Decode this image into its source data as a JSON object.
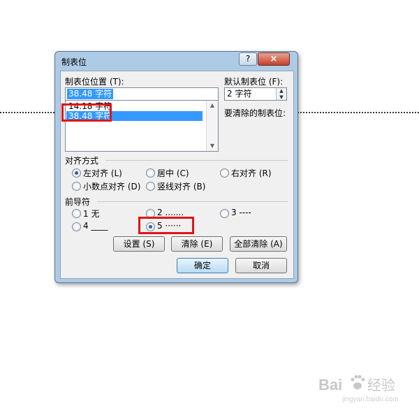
{
  "dialog": {
    "title": "制表位",
    "help_label": "?",
    "close_label": "×"
  },
  "tab_position": {
    "label": "制表位位置 (T):",
    "value": "38.48 字符",
    "list": [
      "14.18 字符",
      "38.48 字符"
    ]
  },
  "default_tab": {
    "label": "默认制表位 (F):",
    "value": "2 字符"
  },
  "clear_label": "要清除的制表位:",
  "alignment": {
    "heading": "对齐方式",
    "options": [
      "左对齐 (L)",
      "居中 (C)",
      "右对齐 (R)",
      "小数点对齐 (D)",
      "竖线对齐 (B)"
    ],
    "selected": "左对齐 (L)"
  },
  "leader": {
    "heading": "前导符",
    "options": [
      "1 无",
      "2 .......",
      "3 ----",
      "4 ____",
      "5 ······"
    ],
    "selected": "5 ······"
  },
  "buttons": {
    "set": "设置 (S)",
    "clear": "清除 (E)",
    "clear_all": "全部清除 (A)",
    "ok": "确定",
    "cancel": "取消"
  },
  "watermark": {
    "brand": "Bai",
    "text": "经验",
    "url": "jingyan.baidu.com"
  }
}
